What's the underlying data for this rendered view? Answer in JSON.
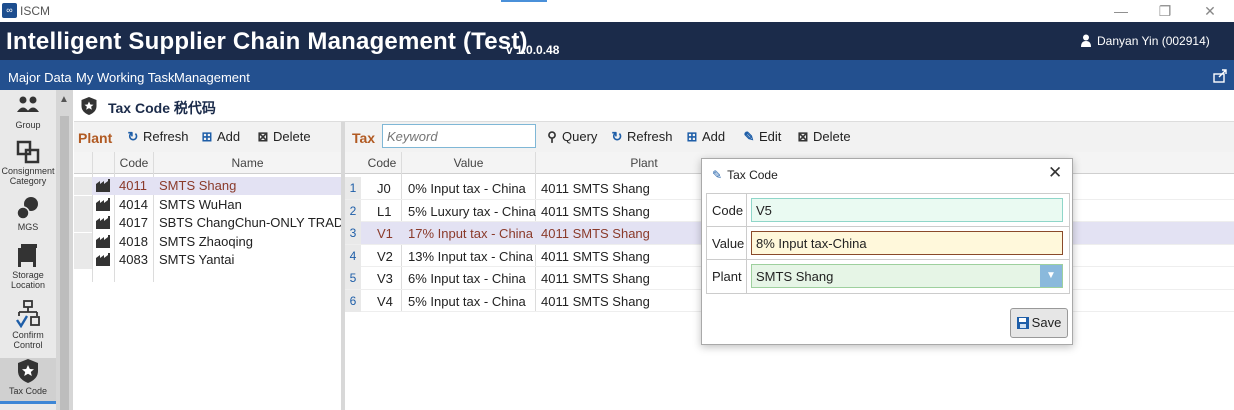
{
  "window": {
    "app_icon": "app-logo-icon",
    "title": "ISCM",
    "controls": [
      "minimize-icon",
      "restore-icon",
      "close-icon"
    ]
  },
  "header": {
    "title": "Intelligent Supplier Chain Management (Test)",
    "version": "v 1.0.0.48",
    "user": "Danyan Yin (002914)"
  },
  "menu": {
    "items": [
      "Major Data",
      "My Working Task",
      "Management"
    ]
  },
  "nav": {
    "items": [
      {
        "label": "Group",
        "icon": "group-icon"
      },
      {
        "label": "Consignment Category",
        "icon": "consignment-category-icon"
      },
      {
        "label": "MGS",
        "icon": "mgs-icon"
      },
      {
        "label": "Storage Location",
        "icon": "storage-location-icon"
      },
      {
        "label": "Confirm Control",
        "icon": "confirm-control-icon"
      },
      {
        "label": "Tax Code",
        "icon": "tax-code-icon"
      }
    ]
  },
  "page": {
    "title": "Tax Code 税代码"
  },
  "plant_panel": {
    "label": "Plant",
    "buttons": {
      "refresh": "Refresh",
      "add": "Add",
      "delete": "Delete"
    },
    "columns": [
      "Code",
      "Name"
    ],
    "rows": [
      {
        "code": "4011",
        "name": "SMTS Shang",
        "selected": true
      },
      {
        "code": "4014",
        "name": "SMTS WuHan"
      },
      {
        "code": "4017",
        "name": "SBTS ChangChun-ONLY TRADE"
      },
      {
        "code": "4018",
        "name": "SMTS Zhaoqing"
      },
      {
        "code": "4083",
        "name": "SMTS Yantai"
      }
    ]
  },
  "tax_panel": {
    "label": "Tax",
    "search_placeholder": "Keyword",
    "buttons": {
      "query": "Query",
      "refresh": "Refresh",
      "add": "Add",
      "edit": "Edit",
      "delete": "Delete"
    },
    "columns": [
      "Code",
      "Value",
      "Plant"
    ],
    "rows": [
      {
        "num": "1",
        "code": "J0",
        "value": "0% Input tax - China",
        "plant": "4011 SMTS Shang"
      },
      {
        "num": "2",
        "code": "L1",
        "value": "5% Luxury tax - China",
        "plant": "4011 SMTS Shang"
      },
      {
        "num": "3",
        "code": "V1",
        "value": "17% Input tax - China",
        "plant": "4011 SMTS Shang",
        "selected": true
      },
      {
        "num": "4",
        "code": "V2",
        "value": "13% Input tax - China",
        "plant": "4011 SMTS Shang"
      },
      {
        "num": "5",
        "code": "V3",
        "value": "6% Input tax - China",
        "plant": "4011 SMTS Shang"
      },
      {
        "num": "6",
        "code": "V4",
        "value": "5% Input tax - China",
        "plant": "4011 SMTS Shang"
      }
    ]
  },
  "dialog": {
    "title": "Tax Code",
    "fields": {
      "code": {
        "label": "Code",
        "value": "V5"
      },
      "value": {
        "label": "Value",
        "value": "8% Input tax-China"
      },
      "plant": {
        "label": "Plant",
        "value": "SMTS Shang"
      }
    },
    "save_label": "Save"
  },
  "colors": {
    "header": "#1b2b4a",
    "menubar": "#23508f",
    "accent": "#b15a22",
    "selection": "#e3e2f3"
  }
}
